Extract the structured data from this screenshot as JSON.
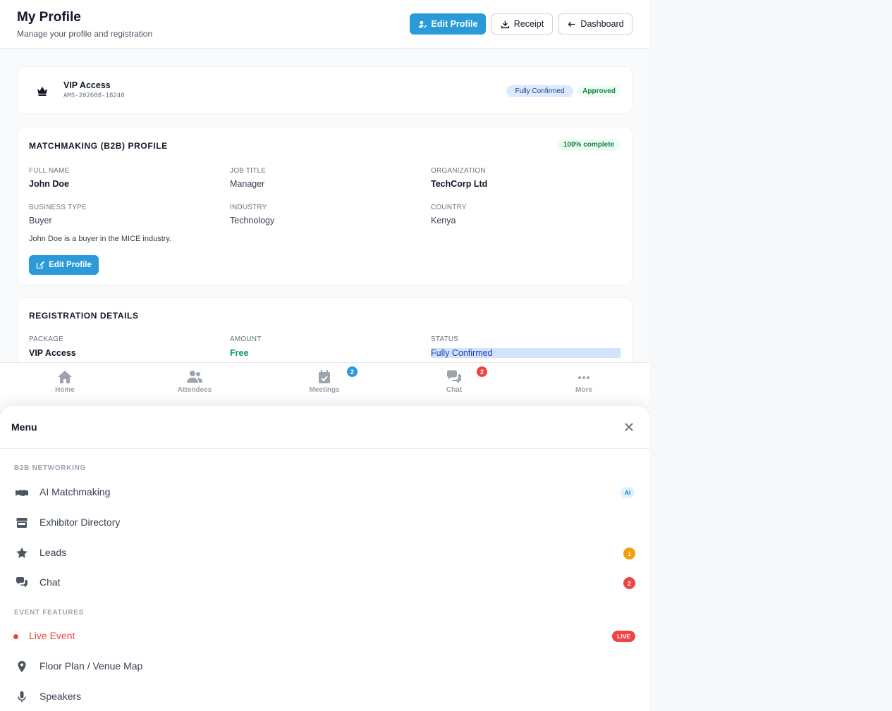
{
  "header": {
    "title": "My Profile",
    "subtitle": "Manage your profile and registration",
    "edit_profile_label": "Edit Profile",
    "receipt_label": "Receipt",
    "dashboard_label": "Dashboard"
  },
  "ticket": {
    "name": "VIP Access",
    "code": "AMS-202608-18240",
    "status_badge": "Fully Confirmed",
    "approval_badge": "Approved"
  },
  "b2b_profile": {
    "title": "MATCHMAKING (B2B) PROFILE",
    "completion": "100% complete",
    "fields": [
      {
        "label": "FULL NAME",
        "value": "John Doe"
      },
      {
        "label": "JOB TITLE",
        "value": "Manager"
      },
      {
        "label": "ORGANIZATION",
        "value": "TechCorp Ltd"
      },
      {
        "label": "BUSINESS TYPE",
        "value": "Buyer"
      },
      {
        "label": "INDUSTRY",
        "value": "Technology"
      },
      {
        "label": "COUNTRY",
        "value": "Kenya"
      }
    ],
    "bio": "John Doe is a buyer in the MICE industry.",
    "edit_label": "Edit Profile"
  },
  "registration": {
    "title": "REGISTRATION DETAILS",
    "fields": [
      {
        "label": "PACKAGE",
        "value": "VIP Access"
      },
      {
        "label": "AMOUNT",
        "value": "Free"
      },
      {
        "label": "STATUS",
        "value": "Fully Confirmed"
      }
    ]
  },
  "bottom_nav": {
    "items": [
      {
        "label": "Home",
        "icon": "home-icon"
      },
      {
        "label": "Attendees",
        "icon": "users-icon"
      },
      {
        "label": "Meetings",
        "icon": "calendar-icon",
        "badge": "2"
      },
      {
        "label": "Chat",
        "icon": "chat-icon",
        "badge": "2"
      },
      {
        "label": "More",
        "icon": "more-icon"
      }
    ]
  },
  "menu": {
    "title": "Menu",
    "sections": [
      {
        "title": "B2B NETWORKING",
        "items": [
          {
            "label": "AI Matchmaking",
            "icon": "handshake-icon",
            "badge": "AI"
          },
          {
            "label": "Exhibitor Directory",
            "icon": "store-icon"
          },
          {
            "label": "Leads",
            "icon": "star-icon",
            "badge": "1"
          },
          {
            "label": "Chat",
            "icon": "chat-icon",
            "badge": "2"
          }
        ]
      },
      {
        "title": "EVENT FEATURES",
        "items": [
          {
            "label": "Live Event",
            "icon": "live-dot-icon",
            "badge": "LIVE"
          },
          {
            "label": "Floor Plan / Venue Map",
            "icon": "map-pin-icon"
          },
          {
            "label": "Speakers",
            "icon": "microphone-icon"
          }
        ]
      }
    ]
  },
  "colors": {
    "primary": "#2a9ad8",
    "success": "#15803d",
    "danger": "#ef4444",
    "warning": "#f59e0b"
  }
}
